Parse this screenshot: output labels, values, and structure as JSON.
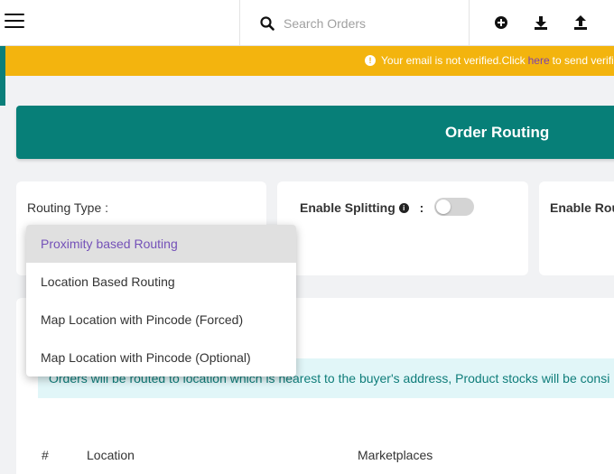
{
  "topbar": {
    "search_placeholder": "Search Orders",
    "icons": [
      "menu-icon",
      "search-icon",
      "add-icon",
      "download-icon",
      "upload-icon"
    ]
  },
  "banner": {
    "text_before": "Your email is not verified.Click",
    "link": "here",
    "text_after": "to send verifi",
    "color": "#f3b40e",
    "link_color": "#7a3fb0"
  },
  "header": {
    "title": "Order Routing",
    "color": "#077f78"
  },
  "settings": {
    "routing_type_label": "Routing Type :",
    "enable_splitting_label": "Enable Splitting",
    "enable_splitting_colon": ":",
    "enable_splitting_on": false,
    "enable_rou_label": "Enable Rou"
  },
  "routing_options": {
    "selected": "Proximity based Routing",
    "items": [
      "Proximity based Routing",
      "Location Based Routing",
      "Map Location with Pincode (Forced)",
      "Map Location with Pincode (Optional)"
    ]
  },
  "notice": {
    "text": "Orders will be routed to location which is nearest to the buyer's address, Product stocks will be consi"
  },
  "table": {
    "columns": [
      "#",
      "Location",
      "Marketplaces"
    ]
  }
}
